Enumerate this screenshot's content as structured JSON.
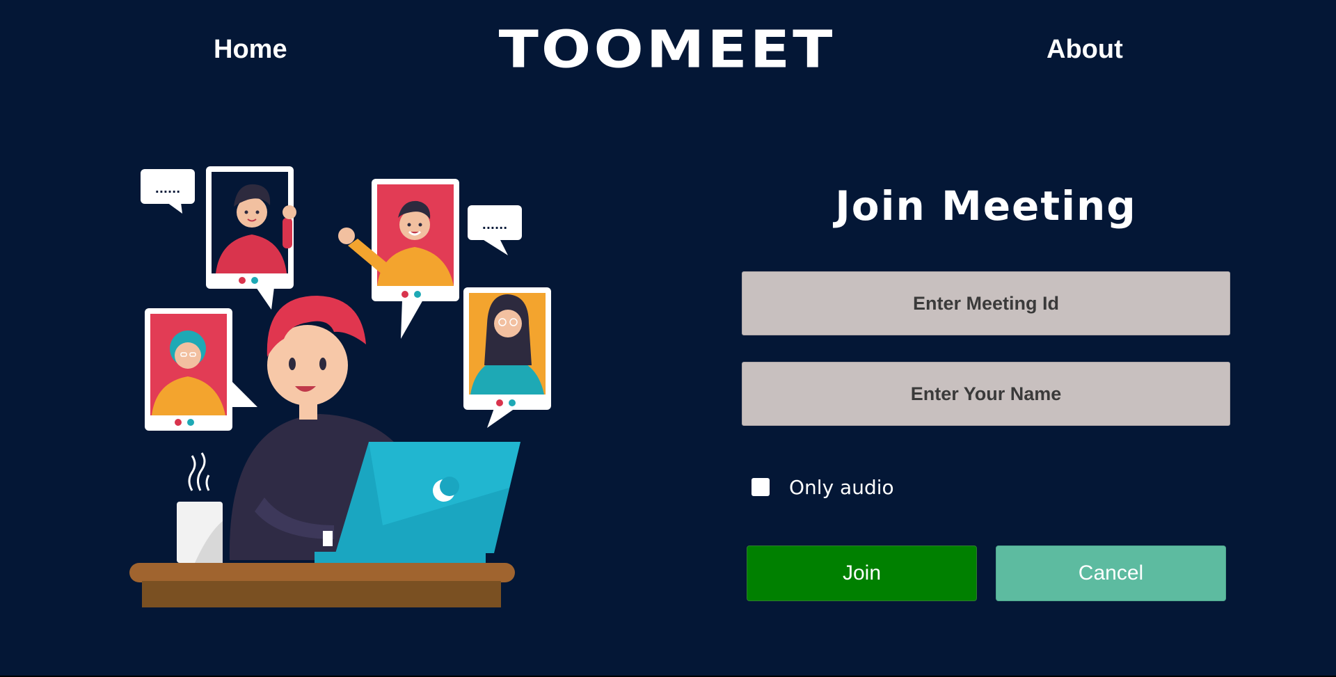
{
  "header": {
    "home_label": "Home",
    "brand": "TOOMEET",
    "about_label": "About"
  },
  "form": {
    "title": "Join Meeting",
    "meeting_id_placeholder": "Enter Meeting Id",
    "name_placeholder": "Enter Your Name",
    "audio_label": "Only audio",
    "audio_checked": false,
    "join_label": "Join",
    "cancel_label": "Cancel"
  },
  "illustration": {
    "bubble_text_1": "......",
    "bubble_text_2": "......"
  },
  "colors": {
    "background": "#041736",
    "input_bg": "#c8c0bf",
    "join_bg": "#008000",
    "cancel_bg": "#5dbba0"
  }
}
